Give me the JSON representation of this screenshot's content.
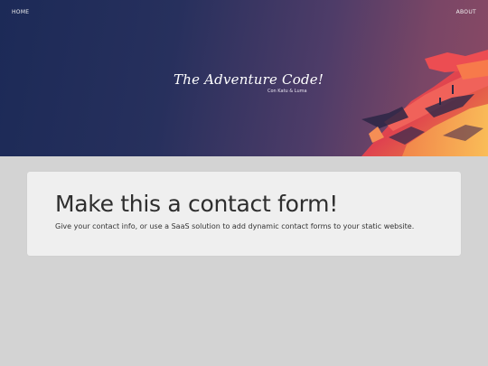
{
  "nav": {
    "home_label": "HOME",
    "about_label": "ABOUT"
  },
  "hero": {
    "title": "The Adventure Code!",
    "subtitle": "Con Katu & Luma",
    "art": "abstract-landscape-illustration"
  },
  "main": {
    "heading": "Make this a contact form!",
    "text": "Give your contact info, or use a SaaS solution to add dynamic contact forms to your static website."
  },
  "colors": {
    "page_background": "#d3d3d3",
    "card_background": "#efefef",
    "hero_gradient_start": "#1c2a57",
    "hero_gradient_end": "#8a4a64",
    "art_accent": "#f0564a"
  }
}
